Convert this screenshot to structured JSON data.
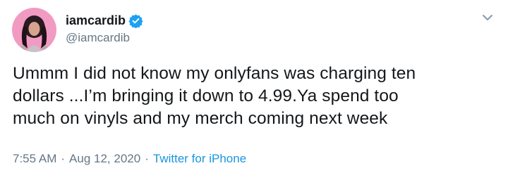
{
  "author": {
    "display_name": "iamcardib",
    "handle": "@iamcardib",
    "verified": true
  },
  "tweet": {
    "lines": [
      "Ummm I did not know my onlyfans was charging ten",
      "dollars ...I’m bringing it down to 4.99.Ya spend too",
      "much on vinyls and my merch coming next week"
    ]
  },
  "meta": {
    "time": "7:55 AM",
    "separator_1": "·",
    "date": "Aug 12, 2020",
    "separator_2": "·",
    "source": "Twitter for iPhone"
  },
  "colors": {
    "verified_badge": "#1da1f2",
    "link": "#1b95e0",
    "secondary_text": "#657786",
    "avatar_background": "#f29bc2"
  },
  "icons": {
    "verified": "verified-badge-icon",
    "menu": "chevron-down-icon"
  }
}
